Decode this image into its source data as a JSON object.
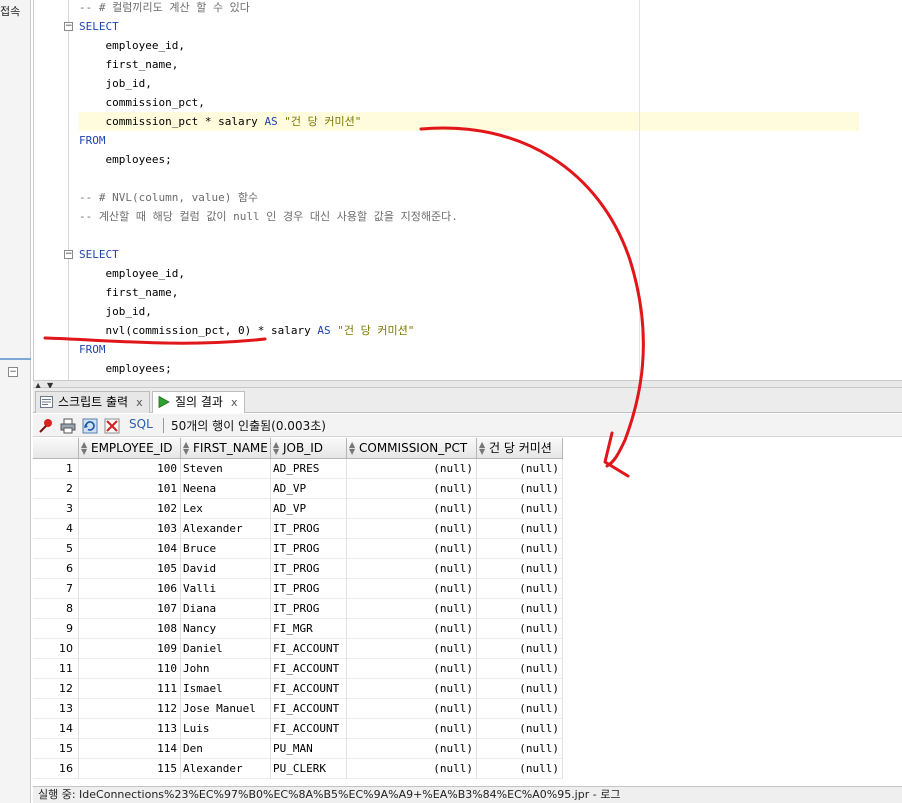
{
  "left_panel": {
    "label": "접속"
  },
  "editor": {
    "lines": [
      {
        "kind": "comment",
        "text": "-- # 컬럼끼리도 계산 할 수 있다"
      },
      {
        "kind": "keyword",
        "text": "SELECT"
      },
      {
        "kind": "plain",
        "text": "    employee_id,"
      },
      {
        "kind": "plain",
        "text": "    first_name,"
      },
      {
        "kind": "plain",
        "text": "    job_id,"
      },
      {
        "kind": "plain",
        "text": "    commission_pct,"
      },
      {
        "kind": "expr1",
        "pre": "    commission_pct * salary ",
        "kw": "AS",
        "str": " \"건 당 커미션\""
      },
      {
        "kind": "keyword",
        "text": "FROM"
      },
      {
        "kind": "plain",
        "text": "    employees;"
      },
      {
        "kind": "blank",
        "text": ""
      },
      {
        "kind": "comment",
        "text": "-- # NVL(column, value) 함수"
      },
      {
        "kind": "comment",
        "text": "-- 계산할 때 해당 컬럼 값이 null 인 경우 대신 사용할 값을 지정해준다."
      },
      {
        "kind": "blank",
        "text": ""
      },
      {
        "kind": "keyword",
        "text": "SELECT"
      },
      {
        "kind": "plain",
        "text": "    employee_id,"
      },
      {
        "kind": "plain",
        "text": "    first_name,"
      },
      {
        "kind": "plain",
        "text": "    job_id,"
      },
      {
        "kind": "expr2",
        "pre": "    nvl(commission_pct, 0) * salary ",
        "kw": "AS",
        "str": " \"건 당 커미션\""
      },
      {
        "kind": "keyword",
        "text": "FROM"
      },
      {
        "kind": "plain",
        "text": "    employees;"
      }
    ]
  },
  "tabs": [
    {
      "label": "스크립트 출력",
      "close": "x",
      "active": false
    },
    {
      "label": "질의 결과",
      "close": "x",
      "active": true
    }
  ],
  "toolbar": {
    "sql_label": "SQL",
    "status": "50개의 행이 인출됨(0.003초)"
  },
  "grid": {
    "columns": [
      "EMPLOYEE_ID",
      "FIRST_NAME",
      "JOB_ID",
      "COMMISSION_PCT",
      "건 당 커미션"
    ],
    "rows": [
      [
        "1",
        "100",
        "Steven",
        "AD_PRES",
        "(null)",
        "(null)"
      ],
      [
        "2",
        "101",
        "Neena",
        "AD_VP",
        "(null)",
        "(null)"
      ],
      [
        "3",
        "102",
        "Lex",
        "AD_VP",
        "(null)",
        "(null)"
      ],
      [
        "4",
        "103",
        "Alexander",
        "IT_PROG",
        "(null)",
        "(null)"
      ],
      [
        "5",
        "104",
        "Bruce",
        "IT_PROG",
        "(null)",
        "(null)"
      ],
      [
        "6",
        "105",
        "David",
        "IT_PROG",
        "(null)",
        "(null)"
      ],
      [
        "7",
        "106",
        "Valli",
        "IT_PROG",
        "(null)",
        "(null)"
      ],
      [
        "8",
        "107",
        "Diana",
        "IT_PROG",
        "(null)",
        "(null)"
      ],
      [
        "9",
        "108",
        "Nancy",
        "FI_MGR",
        "(null)",
        "(null)"
      ],
      [
        "10",
        "109",
        "Daniel",
        "FI_ACCOUNT",
        "(null)",
        "(null)"
      ],
      [
        "11",
        "110",
        "John",
        "FI_ACCOUNT",
        "(null)",
        "(null)"
      ],
      [
        "12",
        "111",
        "Ismael",
        "FI_ACCOUNT",
        "(null)",
        "(null)"
      ],
      [
        "13",
        "112",
        "Jose Manuel",
        "FI_ACCOUNT",
        "(null)",
        "(null)"
      ],
      [
        "14",
        "113",
        "Luis",
        "FI_ACCOUNT",
        "(null)",
        "(null)"
      ],
      [
        "15",
        "114",
        "Den",
        "PU_MAN",
        "(null)",
        "(null)"
      ],
      [
        "16",
        "115",
        "Alexander",
        "PU_CLERK",
        "(null)",
        "(null)"
      ]
    ]
  },
  "bottom_bar": {
    "text": "실행 중: IdeConnections%23%EC%97%B0%EC%8A%B5%EC%9A%A9+%EA%B3%84%EC%A0%95.jpr - 로그"
  },
  "annotation_color": "#e0161b",
  "keyword_color": "#1f44b0",
  "comment_color": "#6d6d6d",
  "string_color": "#7a7a00"
}
